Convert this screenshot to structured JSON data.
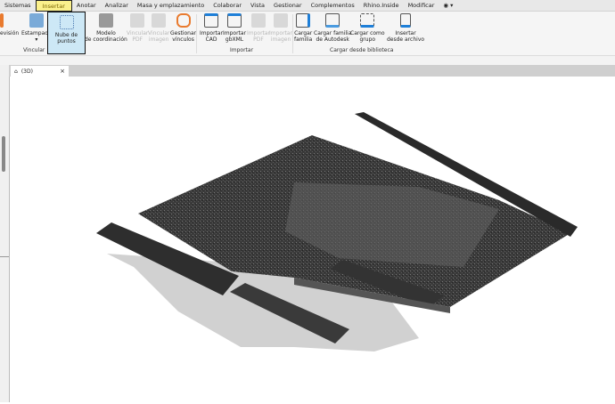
{
  "menu": [
    "Sistemas",
    "Insertar",
    "Anotar",
    "Analizar",
    "Masa y emplazamiento",
    "Colaborar",
    "Vista",
    "Gestionar",
    "Complementos",
    "Rhino.Inside",
    "Modificar",
    "◉ ▾"
  ],
  "ribbon": {
    "revision": "evisión",
    "estampado": "Estampado",
    "nube": [
      "Nube de",
      "puntos"
    ],
    "modelo": [
      "Modelo",
      "de coordinación"
    ],
    "vincular_pdf": [
      "Vincular",
      "PDF"
    ],
    "vincular_imagen": [
      "Vincular",
      "imagen"
    ],
    "gestionar": [
      "Gestionar",
      "vínculos"
    ],
    "importar_cad": [
      "Importar",
      "CAD"
    ],
    "importar_gbxml": [
      "Importar",
      "gbXML"
    ],
    "importar_pdf": [
      "Importar",
      "PDF"
    ],
    "importar_imagen": [
      "Importar",
      "imagen"
    ],
    "cargar_familia": [
      "Cargar",
      "familia"
    ],
    "cargar_autodesk": [
      "Cargar familia",
      "de Autodesk"
    ],
    "cargar_grupo": [
      "Cargar como",
      "grupo"
    ],
    "insertar_archivo": [
      "Insertar",
      "desde archivo"
    ],
    "groups": {
      "vincular": "Vincular",
      "importar": "Importar",
      "cargar": "Cargar desde biblioteca"
    }
  },
  "view_tab": {
    "label": "(3D)"
  },
  "colors": {
    "accent": "#1e7fd8",
    "highlight": "#fbf08c",
    "selected": "#cde8f6"
  }
}
